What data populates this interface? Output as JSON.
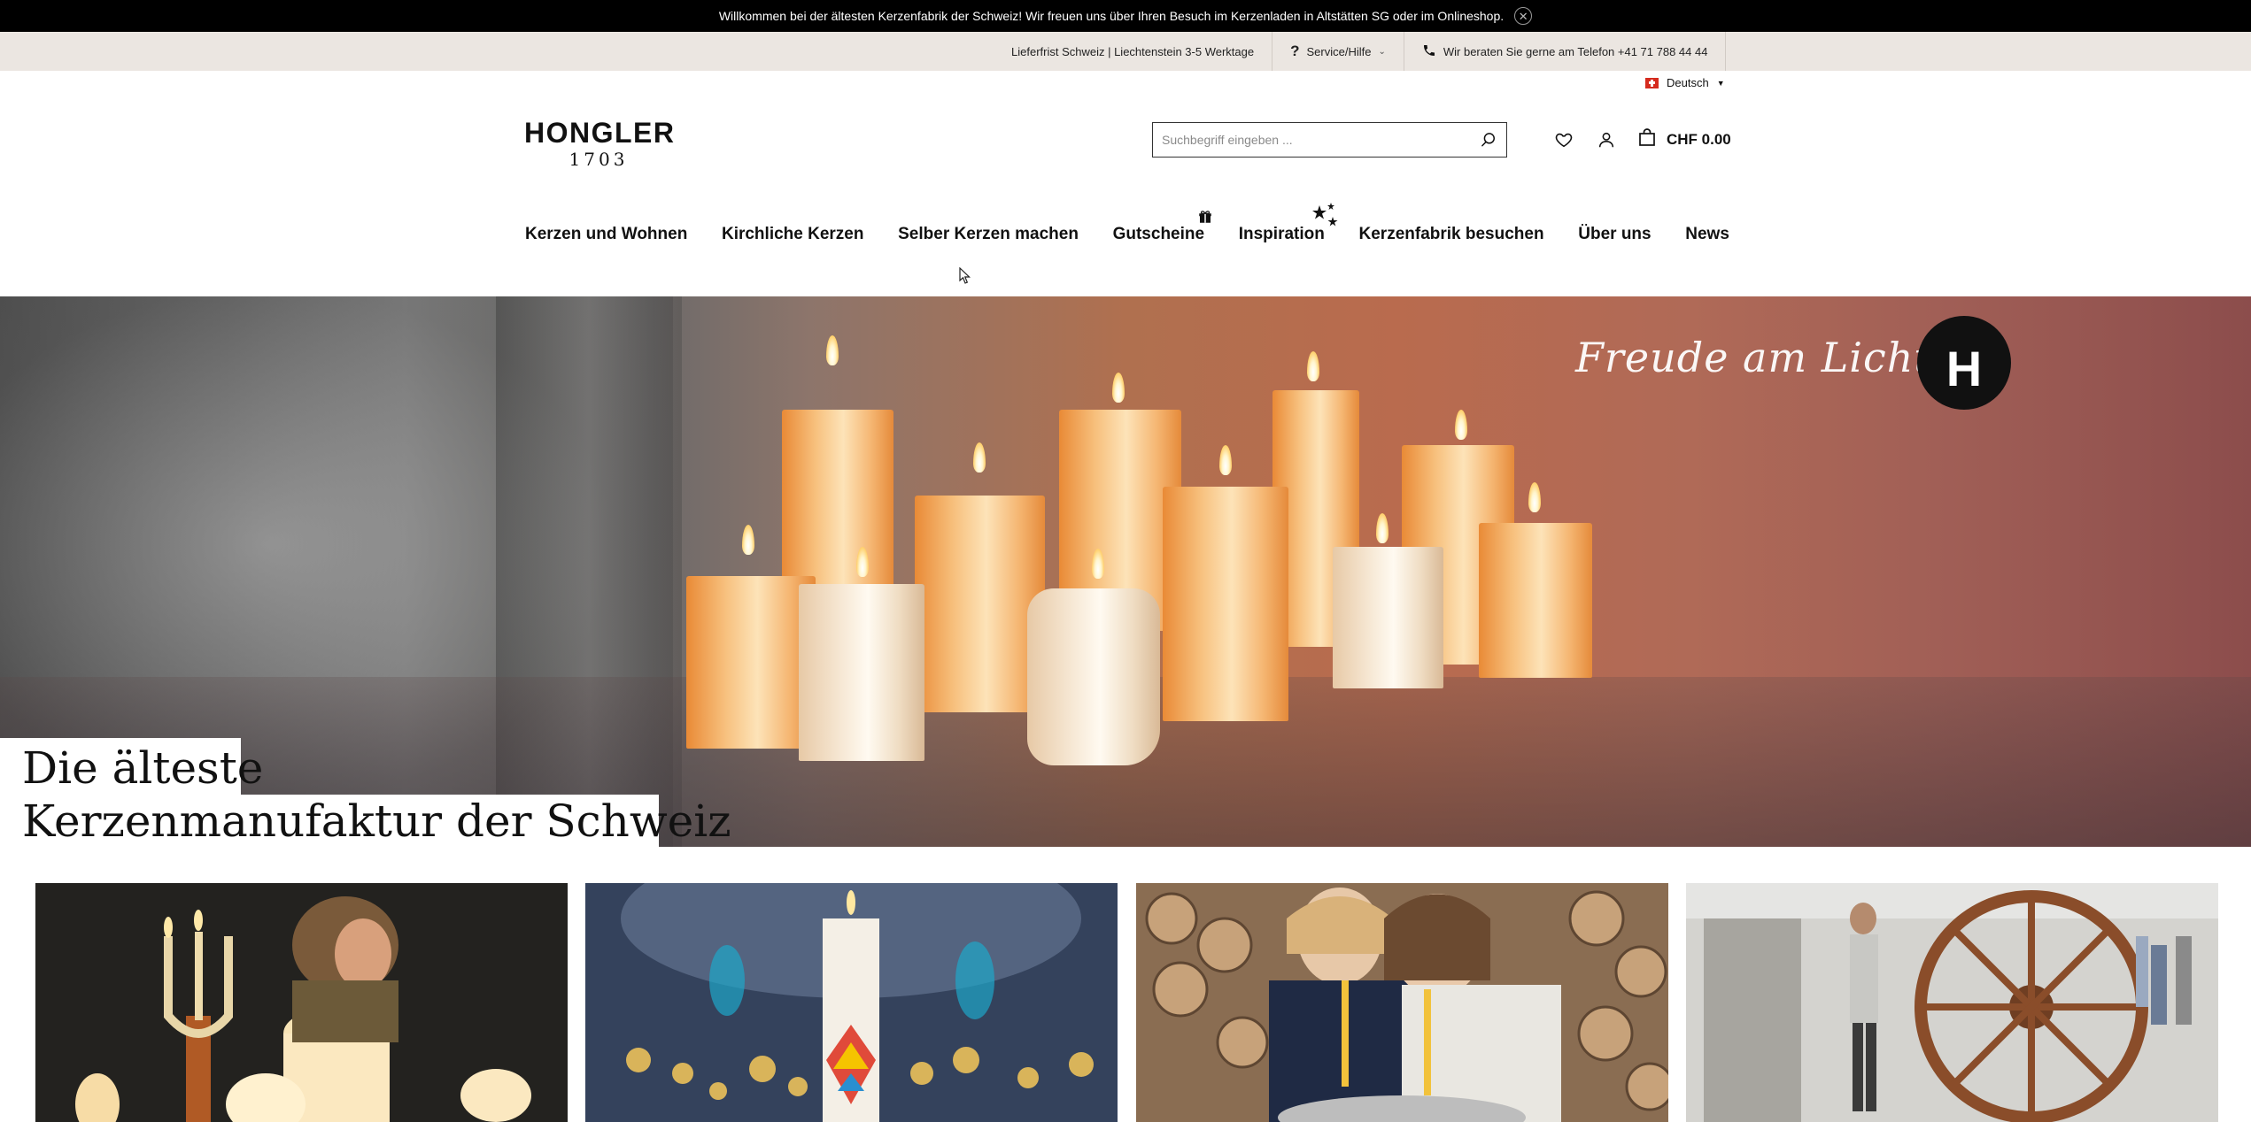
{
  "announcement": {
    "text": "Willkommen bei der ältesten Kerzenfabrik der Schweiz! Wir freuen uns über Ihren Besuch im Kerzenladen in Altstätten SG oder im Onlineshop."
  },
  "service_bar": {
    "delivery": "Lieferfrist Schweiz | Liechtenstein 3-5 Werktage",
    "service_label": "Service/Hilfe",
    "phone_text": "Wir beraten Sie gerne am Telefon +41 71 788 44 44"
  },
  "language": {
    "label": "Deutsch"
  },
  "logo": {
    "name": "HONGLER",
    "year": "1703"
  },
  "search": {
    "placeholder": "Suchbegriff eingeben ...",
    "value": ""
  },
  "cart": {
    "amount": "CHF 0.00"
  },
  "nav": {
    "items": [
      {
        "label": "Kerzen und Wohnen"
      },
      {
        "label": "Kirchliche Kerzen"
      },
      {
        "label": "Selber Kerzen machen"
      },
      {
        "label": "Gutscheine"
      },
      {
        "label": "Inspiration"
      },
      {
        "label": "Kerzenfabrik besuchen"
      },
      {
        "label": "Über uns"
      },
      {
        "label": "News"
      }
    ]
  },
  "hero": {
    "tagline": "Freude am Licht",
    "badge_letter": "H",
    "headline_line1": "Die älteste",
    "headline_line2": "Kerzenmanufaktur der Schweiz"
  },
  "colors": {
    "announcement_bg": "#000000",
    "service_bar_bg": "#ebe6e1",
    "text": "#111111"
  },
  "icons": [
    "close-icon",
    "question-icon",
    "chevron-down-icon",
    "phone-icon",
    "swiss-flag-icon",
    "caret-down-icon",
    "search-icon",
    "heart-icon",
    "user-icon",
    "shopping-bag-icon",
    "gift-icon",
    "sparkle-icon",
    "mouse-cursor-icon"
  ]
}
